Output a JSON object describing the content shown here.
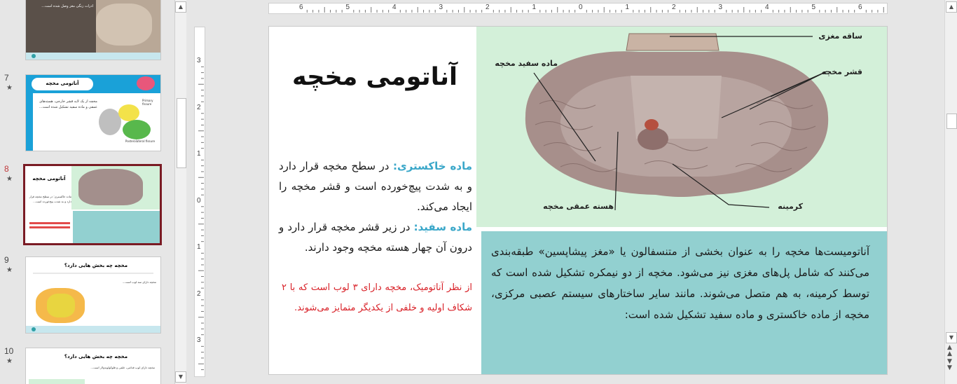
{
  "thumbnails": [
    {
      "number": "",
      "title": "",
      "body": "ادرات زنگی مغز وصل شده است..."
    },
    {
      "number": "7",
      "title": "آناتومی مخچه",
      "fissure_top": "Primary fissure",
      "fissure_bottom": "Posterolateral fissure",
      "body": "مخچه از یک لایه قشر خارجی، هسته‌های عمقی و ماده سفید تشکیل شده است..."
    },
    {
      "number": "8",
      "title": "آناتومی مخچه",
      "body": "ماده خاکستری: در سطح مخچه قرار دارد و به شدت پیچ‌خورده است..."
    },
    {
      "number": "9",
      "title": "مخچه چه بخش هایی دارد؟",
      "body": "مخچه دارای سه لوب است..."
    },
    {
      "number": "10",
      "title": "مخچه چه بخش هایی دارد؟",
      "body": "مخچه دارای لوب قدامی، خلفی و فلوکولوندولار است..."
    }
  ],
  "ruler": {
    "h_ticks": [
      "6",
      "5",
      "4",
      "3",
      "2",
      "1",
      "0",
      "1",
      "2",
      "3",
      "4",
      "5",
      "6"
    ],
    "v_ticks": [
      "3",
      "2",
      "1",
      "0",
      "1",
      "2",
      "3"
    ]
  },
  "slide": {
    "title": "آناتومی مخچه",
    "gray_matter_term": "ماده خاکستری:",
    "gray_matter_text": " در سطح مخچه قرار دارد و به شدت پیچ‌خورده است و قشر مخچه را ایجاد می‌کند.",
    "white_matter_term": "ماده سفید:",
    "white_matter_text": " در زیر قشر مخچه قرار دارد و درون آن چهار هسته مخچه وجود دارند.",
    "red_note": "از نظر آناتومیک، مخچه دارای ۳ لوب است که با ۲ شکاف اولیه و خلفی از یکدیگر متمایز می‌شوند.",
    "teal_text": "آناتومیست‌ها مخچه را به عنوان بخشی از متنسفالون یا «مغز پیشاپسین» طبقه‌بندی می‌کنند که شامل پل‌های مغزی نیز می‌شود. مخچه از دو نیمکره تشکیل شده است که توسط کرمینه، به هم متصل می‌شوند. مانند سایر ساختارهای سیستم عصبی مرکزی، مخچه از ماده خاکستری و ماده سفید تشکیل شده است:",
    "labels": {
      "brainstem": "ساقه مغزی",
      "white_matter": "ماده سفید مخچه",
      "cortex": "قشر مخچه",
      "deep_nucleus": "هسته عمقی مخچه",
      "vermis": "کرمینه"
    }
  },
  "colors": {
    "accent_red": "#d81f26",
    "term_teal": "#3aa7c9",
    "panel_green": "#d3f0d9",
    "panel_teal": "#92d0d0",
    "selected_border": "#7a1b24"
  }
}
